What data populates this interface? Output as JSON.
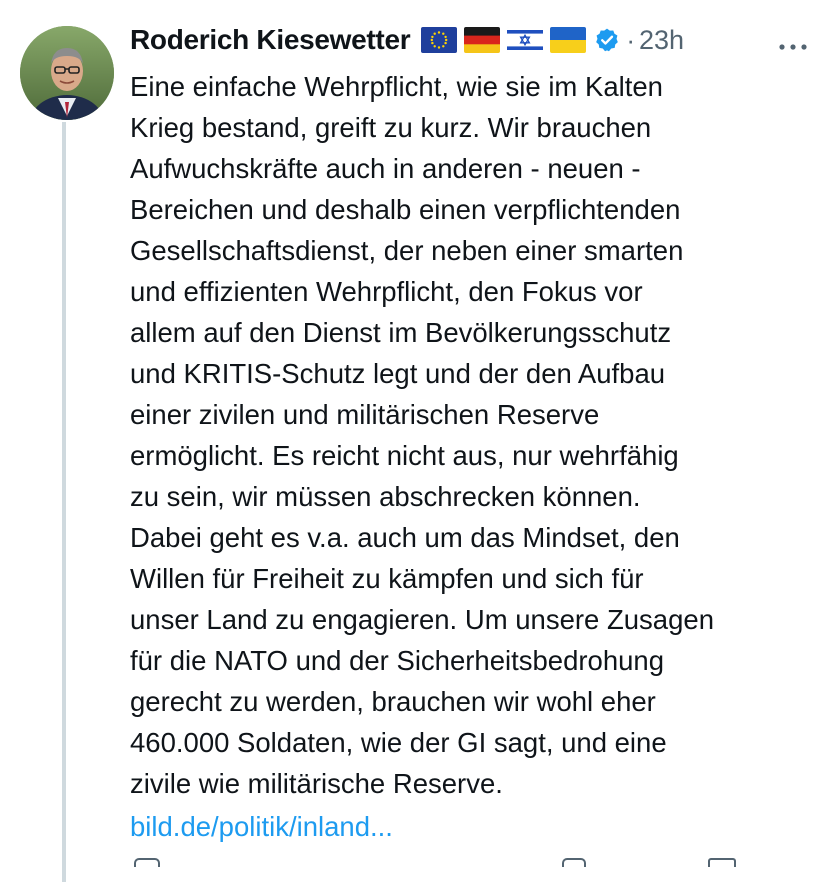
{
  "author": {
    "name": "Roderich Kiesewetter",
    "flags": [
      "eu-flag-icon",
      "germany-flag-icon",
      "israel-flag-icon",
      "ukraine-flag-icon"
    ],
    "verified_icon": "verified-badge-icon"
  },
  "meta": {
    "separator": "·",
    "time": "23h"
  },
  "body_lines": [
    "Eine einfache Wehrpflicht, wie sie im Kalten",
    "Krieg bestand, greift zu kurz. Wir brauchen",
    "Aufwuchskräfte auch in anderen - neuen -",
    "Bereichen und deshalb einen verpflichtenden",
    "Gesellschaftsdienst, der neben einer smarten",
    "und effizienten Wehrpflicht, den Fokus vor",
    "allem auf den Dienst im Bevölkerungsschutz",
    "und KRITIS-Schutz legt und der den Aufbau",
    "einer zivilen und militärischen Reserve",
    "ermöglicht. Es reicht nicht aus, nur wehrfähig",
    "zu sein, wir müssen abschrecken können.",
    "Dabei geht es v.a. auch um das Mindset, den",
    "Willen für Freiheit zu kämpfen und sich für",
    "unser Land zu engagieren. Um unsere Zusagen",
    "für die NATO und der Sicherheitsbedrohung",
    "gerecht zu werden, brauchen wir wohl eher",
    "460.000 Soldaten, wie der GI sagt, und eine",
    "zivile wie militärische Reserve."
  ],
  "link": {
    "text": "bild.de/politik/inland..."
  },
  "colors": {
    "text": "#0f1419",
    "secondary": "#536471",
    "link": "#1d9bf0",
    "verified": "#1d9bf0",
    "thread_line": "#cfd9de"
  }
}
